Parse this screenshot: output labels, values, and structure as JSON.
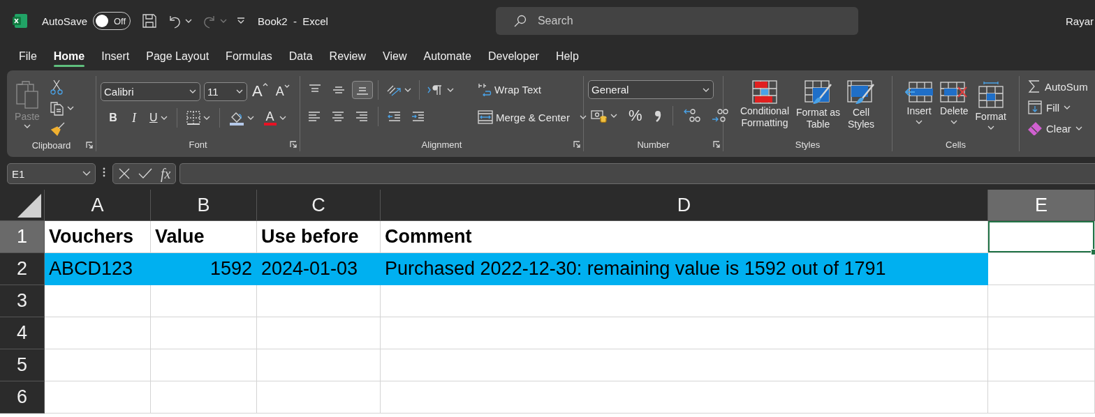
{
  "title_bar": {
    "autosave_label": "AutoSave",
    "autosave_toggle": {
      "on": false,
      "label": "Off"
    },
    "document_title": "Book2  -  Excel",
    "search": {
      "placeholder": "Search"
    },
    "user_name": "Rayar"
  },
  "tabs": [
    {
      "label": "File",
      "selected": false
    },
    {
      "label": "Home",
      "selected": true
    },
    {
      "label": "Insert",
      "selected": false
    },
    {
      "label": "Page Layout",
      "selected": false
    },
    {
      "label": "Formulas",
      "selected": false
    },
    {
      "label": "Data",
      "selected": false
    },
    {
      "label": "Review",
      "selected": false
    },
    {
      "label": "View",
      "selected": false
    },
    {
      "label": "Automate",
      "selected": false
    },
    {
      "label": "Developer",
      "selected": false
    },
    {
      "label": "Help",
      "selected": false
    }
  ],
  "ribbon": {
    "groups": [
      {
        "kind": "clipboard",
        "label": "Clipboard",
        "paste": {
          "label": "Paste",
          "disabled": true
        }
      },
      {
        "kind": "font",
        "label": "Font",
        "font_name": "Calibri",
        "font_size": "11",
        "grow_font": "A",
        "shrink_font": "A",
        "bold": "B",
        "italic": "I",
        "underline": "U",
        "font_color": "A"
      },
      {
        "kind": "alignment",
        "label": "Alignment",
        "vertical_align": [
          {
            "selected": false
          },
          {
            "selected": false
          },
          {
            "selected": true
          }
        ],
        "wrap_text": "Wrap Text",
        "merge": "Merge & Center"
      },
      {
        "kind": "number",
        "label": "Number",
        "number_format": "General",
        "percent": "%"
      },
      {
        "kind": "styles",
        "label": "Styles",
        "buttons": [
          "Conditional\nFormatting",
          "Format as\nTable",
          "Cell\nStyles"
        ]
      },
      {
        "kind": "cells",
        "label": "Cells",
        "buttons": [
          "Insert",
          "Delete",
          "Format"
        ]
      },
      {
        "kind": "editing",
        "buttons": [
          "AutoSum",
          "Fill",
          "Clear"
        ]
      }
    ]
  },
  "formula_bar": {
    "name_box": "E1",
    "function_label": "fx"
  },
  "sheet": {
    "columns": [
      {
        "label": "A",
        "selected": false
      },
      {
        "label": "B",
        "selected": false
      },
      {
        "label": "C",
        "selected": false
      },
      {
        "label": "D",
        "selected": false
      },
      {
        "label": "E",
        "selected": true
      }
    ],
    "rows": [
      {
        "number": "1",
        "selected": true,
        "kind": "header",
        "cells": [
          {
            "text": "Vouchers",
            "numeric": false
          },
          {
            "text": "Value",
            "numeric": false
          },
          {
            "text": "Use before",
            "numeric": false
          },
          {
            "text": "Comment",
            "numeric": false
          }
        ]
      },
      {
        "number": "2",
        "selected": false,
        "kind": "highlighted",
        "cells": [
          {
            "text": "ABCD123",
            "numeric": false
          },
          {
            "text": "1592",
            "numeric": true
          },
          {
            "text": "2024-01-03",
            "numeric": false
          },
          {
            "text": "Purchased 2022-12-30: remaining value is 1592 out of 1791",
            "numeric": false
          }
        ]
      },
      {
        "number": "3",
        "selected": false,
        "kind": "empty"
      },
      {
        "number": "4",
        "selected": false,
        "kind": "empty"
      },
      {
        "number": "5",
        "selected": false,
        "kind": "empty"
      },
      {
        "number": "6",
        "selected": false,
        "kind": "empty"
      }
    ]
  }
}
